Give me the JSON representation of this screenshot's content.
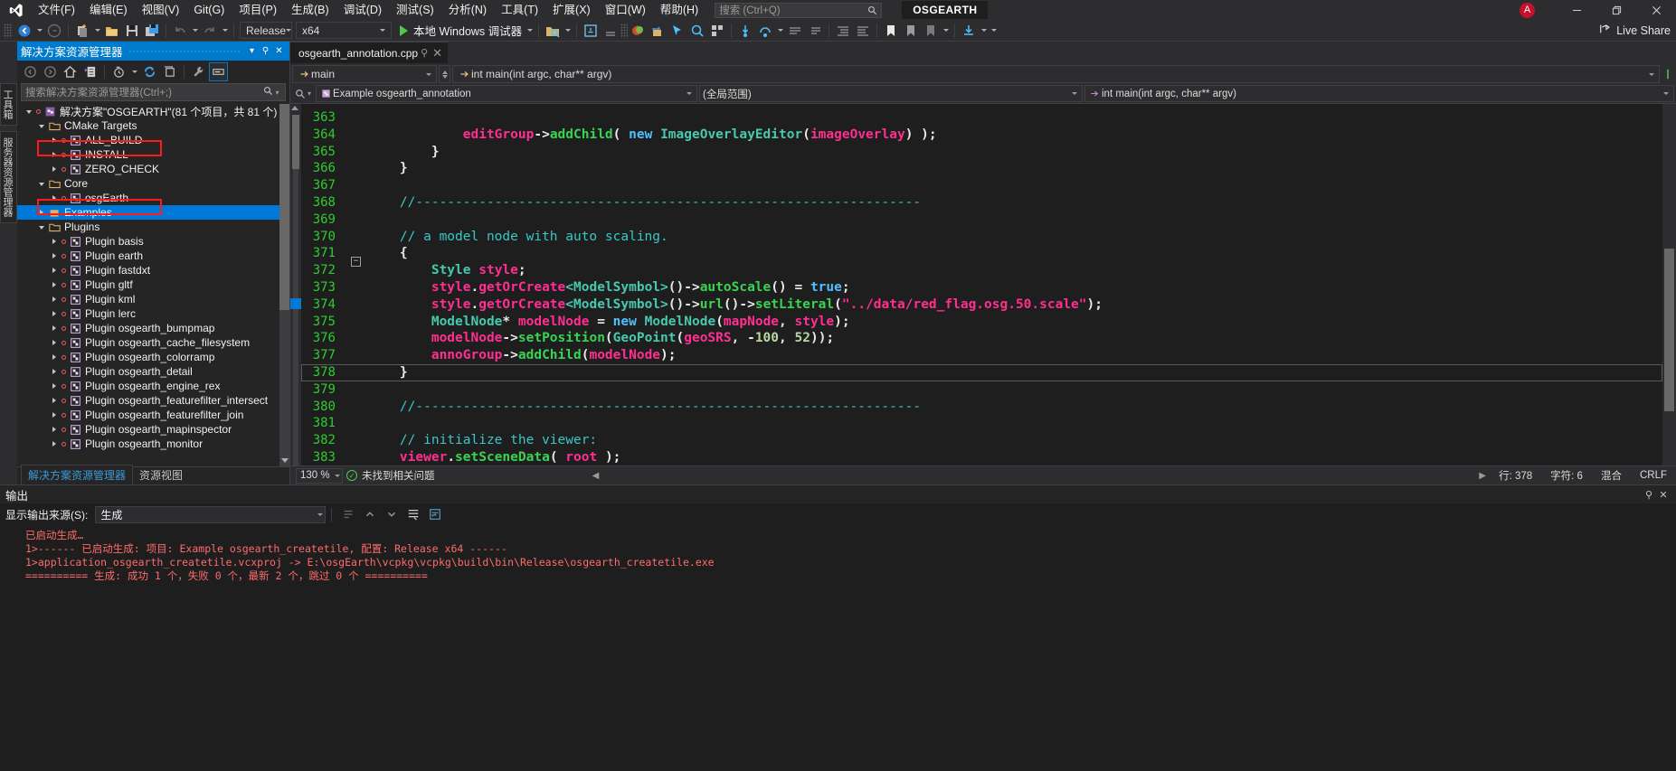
{
  "titlebar": {
    "menus": [
      "文件(F)",
      "编辑(E)",
      "视图(V)",
      "Git(G)",
      "项目(P)",
      "生成(B)",
      "调试(D)",
      "测试(S)",
      "分析(N)",
      "工具(T)",
      "扩展(X)",
      "窗口(W)",
      "帮助(H)"
    ],
    "search_placeholder": "搜索 (Ctrl+Q)",
    "solution_chip": "OSGEARTH",
    "avatar_initial": "A",
    "window_buttons": [
      "minimize-button",
      "restore-button",
      "close-button"
    ]
  },
  "toolbar": {
    "config": "Release",
    "platform": "x64",
    "debug_label": "本地 Windows 调试器",
    "live_share": "Live Share"
  },
  "vertical_tabs": [
    "工具箱",
    "服务器资源管理器"
  ],
  "solution_explorer": {
    "title": "解决方案资源管理器",
    "search_placeholder": "搜索解决方案资源管理器(Ctrl+;)",
    "bottom_tabs": [
      {
        "label": "解决方案资源管理器",
        "active": true
      },
      {
        "label": "资源视图",
        "active": false
      }
    ],
    "tree": [
      {
        "label": "解决方案\"OSGEARTH\"(81 个项目，共 81 个)",
        "depth": 0,
        "kind": "solution",
        "expander": "open",
        "selected": false,
        "dot": true
      },
      {
        "label": "CMake Targets",
        "depth": 1,
        "kind": "folder",
        "expander": "open",
        "selected": false,
        "dot": false
      },
      {
        "label": "ALL_BUILD",
        "depth": 2,
        "kind": "project",
        "expander": "closed",
        "selected": false,
        "dot": true,
        "annotated": true
      },
      {
        "label": "INSTALL",
        "depth": 2,
        "kind": "project",
        "expander": "closed",
        "selected": false,
        "dot": true
      },
      {
        "label": "ZERO_CHECK",
        "depth": 2,
        "kind": "project",
        "expander": "closed",
        "selected": false,
        "dot": true
      },
      {
        "label": "Core",
        "depth": 1,
        "kind": "folder",
        "expander": "open",
        "selected": false,
        "dot": false
      },
      {
        "label": "osgEarth",
        "depth": 2,
        "kind": "project",
        "expander": "closed",
        "selected": false,
        "dot": true,
        "annotated": true
      },
      {
        "label": "Examples",
        "depth": 1,
        "kind": "folder",
        "expander": "closed",
        "selected": true,
        "dot": false
      },
      {
        "label": "Plugins",
        "depth": 1,
        "kind": "folder",
        "expander": "open",
        "selected": false,
        "dot": false
      },
      {
        "label": "Plugin basis",
        "depth": 2,
        "kind": "project",
        "expander": "closed",
        "selected": false,
        "dot": true
      },
      {
        "label": "Plugin earth",
        "depth": 2,
        "kind": "project",
        "expander": "closed",
        "selected": false,
        "dot": true
      },
      {
        "label": "Plugin fastdxt",
        "depth": 2,
        "kind": "project",
        "expander": "closed",
        "selected": false,
        "dot": true
      },
      {
        "label": "Plugin gltf",
        "depth": 2,
        "kind": "project",
        "expander": "closed",
        "selected": false,
        "dot": true
      },
      {
        "label": "Plugin kml",
        "depth": 2,
        "kind": "project",
        "expander": "closed",
        "selected": false,
        "dot": true
      },
      {
        "label": "Plugin lerc",
        "depth": 2,
        "kind": "project",
        "expander": "closed",
        "selected": false,
        "dot": true
      },
      {
        "label": "Plugin osgearth_bumpmap",
        "depth": 2,
        "kind": "project",
        "expander": "closed",
        "selected": false,
        "dot": true
      },
      {
        "label": "Plugin osgearth_cache_filesystem",
        "depth": 2,
        "kind": "project",
        "expander": "closed",
        "selected": false,
        "dot": true
      },
      {
        "label": "Plugin osgearth_colorramp",
        "depth": 2,
        "kind": "project",
        "expander": "closed",
        "selected": false,
        "dot": true
      },
      {
        "label": "Plugin osgearth_detail",
        "depth": 2,
        "kind": "project",
        "expander": "closed",
        "selected": false,
        "dot": true
      },
      {
        "label": "Plugin osgearth_engine_rex",
        "depth": 2,
        "kind": "project",
        "expander": "closed",
        "selected": false,
        "dot": true
      },
      {
        "label": "Plugin osgearth_featurefilter_intersect",
        "depth": 2,
        "kind": "project",
        "expander": "closed",
        "selected": false,
        "dot": true
      },
      {
        "label": "Plugin osgearth_featurefilter_join",
        "depth": 2,
        "kind": "project",
        "expander": "closed",
        "selected": false,
        "dot": true
      },
      {
        "label": "Plugin osgearth_mapinspector",
        "depth": 2,
        "kind": "project",
        "expander": "closed",
        "selected": false,
        "dot": true
      },
      {
        "label": "Plugin osgearth_monitor",
        "depth": 2,
        "kind": "project",
        "expander": "closed",
        "selected": false,
        "dot": true
      }
    ]
  },
  "editor": {
    "tab_title": "osgearth_annotation.cpp",
    "nav_member": "main",
    "nav_signature": "int main(int argc, char** argv)",
    "nav_project": "Example osgearth_annotation",
    "nav_scope": "(全局范围)",
    "zoom": "130 %",
    "issues": "未找到相关问题",
    "status_line": "行: 378",
    "status_col": "字符: 6",
    "status_mode": "混合",
    "status_crlf": "CRLF",
    "first_line_number": 363,
    "lines": [
      {
        "n": 363,
        "text": ""
      },
      {
        "n": 364,
        "text": "            editGroup->addChild( new ImageOverlayEditor(imageOverlay) );"
      },
      {
        "n": 365,
        "text": "        }"
      },
      {
        "n": 366,
        "text": "    }"
      },
      {
        "n": 367,
        "text": ""
      },
      {
        "n": 368,
        "text": "    //----------------------------------------------------------------"
      },
      {
        "n": 369,
        "text": ""
      },
      {
        "n": 370,
        "text": "    // a model node with auto scaling."
      },
      {
        "n": 371,
        "text": "    {"
      },
      {
        "n": 372,
        "text": "        Style style;"
      },
      {
        "n": 373,
        "text": "        style.getOrCreate<ModelSymbol>()->autoScale() = true;"
      },
      {
        "n": 374,
        "text": "        style.getOrCreate<ModelSymbol>()->url()->setLiteral(\"../data/red_flag.osg.50.scale\");"
      },
      {
        "n": 375,
        "text": "        ModelNode* modelNode = new ModelNode(mapNode, style);"
      },
      {
        "n": 376,
        "text": "        modelNode->setPosition(GeoPoint(geoSRS, -100, 52));"
      },
      {
        "n": 377,
        "text": "        annoGroup->addChild(modelNode);"
      },
      {
        "n": 378,
        "text": "    }"
      },
      {
        "n": 379,
        "text": ""
      },
      {
        "n": 380,
        "text": "    //----------------------------------------------------------------"
      },
      {
        "n": 381,
        "text": ""
      },
      {
        "n": 382,
        "text": "    // initialize the viewer:"
      },
      {
        "n": 383,
        "text": "    viewer.setSceneData( root );"
      }
    ]
  },
  "output": {
    "title": "输出",
    "source_label": "显示输出来源(S):",
    "source_value": "生成",
    "lines": [
      "已启动生成…",
      "1>------ 已启动生成: 项目: Example osgearth_createtile, 配置: Release x64 ------",
      "1>application_osgearth_createtile.vcxproj -> E:\\osgEarth\\vcpkg\\vcpkg\\build\\bin\\Release\\osgearth_createtile.exe",
      "========== 生成: 成功 1 个，失败 0 个，最新 2 个，跳过 0 个 =========="
    ]
  },
  "colors": {
    "accent": "#007acc",
    "annotation": "#ff1a1a",
    "selection": "#0078d7",
    "linenumber": "#2ecc2e",
    "comment": "#3ac7c7",
    "identifier": "#ff2f92",
    "method": "#39d353",
    "template": "#47c9b0",
    "background": "#1e1e1e",
    "chrome": "#2d2d30"
  }
}
